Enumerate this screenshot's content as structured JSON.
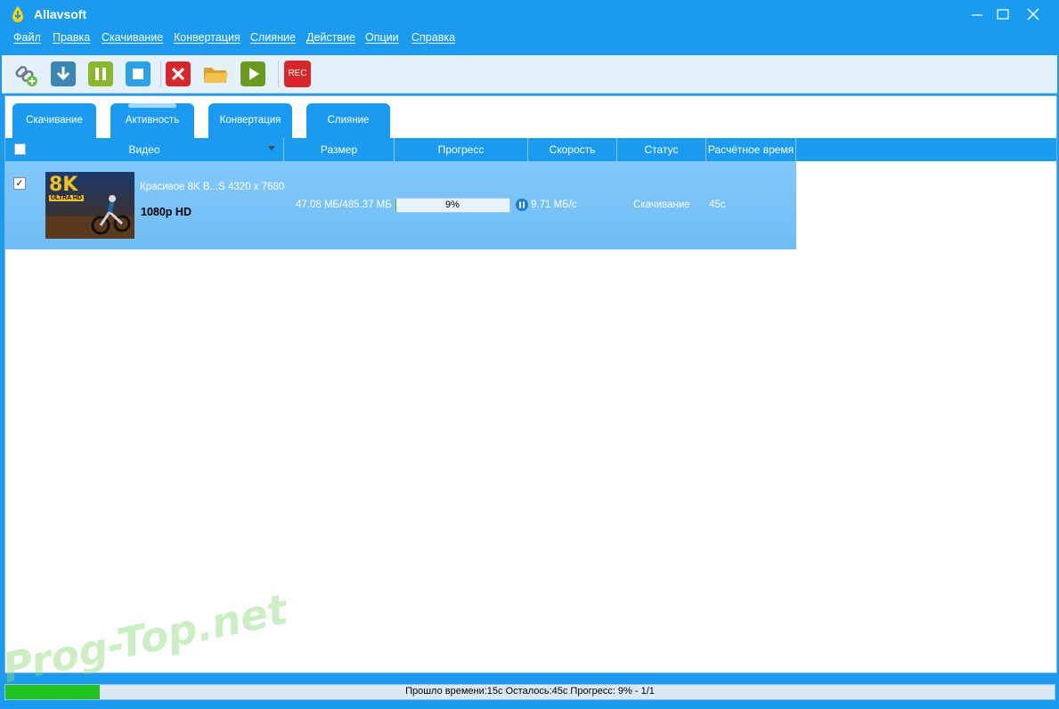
{
  "app": {
    "title": "Allavsoft"
  },
  "menu": [
    "Файл",
    "Правка",
    "Скачивание",
    "Конвертация",
    "Слияние",
    "Действие",
    "Опции",
    "Справка"
  ],
  "toolbar": {
    "buttons": [
      "add-url-icon",
      "download-icon",
      "pause-icon",
      "stop-icon",
      "delete-icon",
      "open-folder-icon",
      "play-icon",
      "record-icon"
    ],
    "rec_label": "REC"
  },
  "tabs": [
    "Скачивание",
    "Активность",
    "Конвертация",
    "Слияние"
  ],
  "active_tab": "Активность",
  "columns": [
    "Видео",
    "Размер",
    "Прогресс",
    "Скорость",
    "Статус",
    "Расчётное время"
  ],
  "row": {
    "checked": true,
    "check_mark": "✓",
    "thumbnail_text": "8K",
    "thumbnail_subtext": "ULTRA HD",
    "title": "Красивое 8K В...S 4320 x 7680",
    "quality": "1080p HD",
    "size": "47.08 МБ/485.37 МБ",
    "progress_percent": 9,
    "progress_label": "9%",
    "speed": "9.71 МБ/с",
    "status": "Скачивание",
    "eta": "45с"
  },
  "statusbar": {
    "text": "Прошло времени:15с Осталось:45с Прогресс: 9% - 1/1",
    "progress_percent": 9
  },
  "watermark": "Prog-Top.net",
  "colors": {
    "accent": "#1a9bf0",
    "row": "#7ac4f8",
    "progress": "#1fc21f"
  }
}
